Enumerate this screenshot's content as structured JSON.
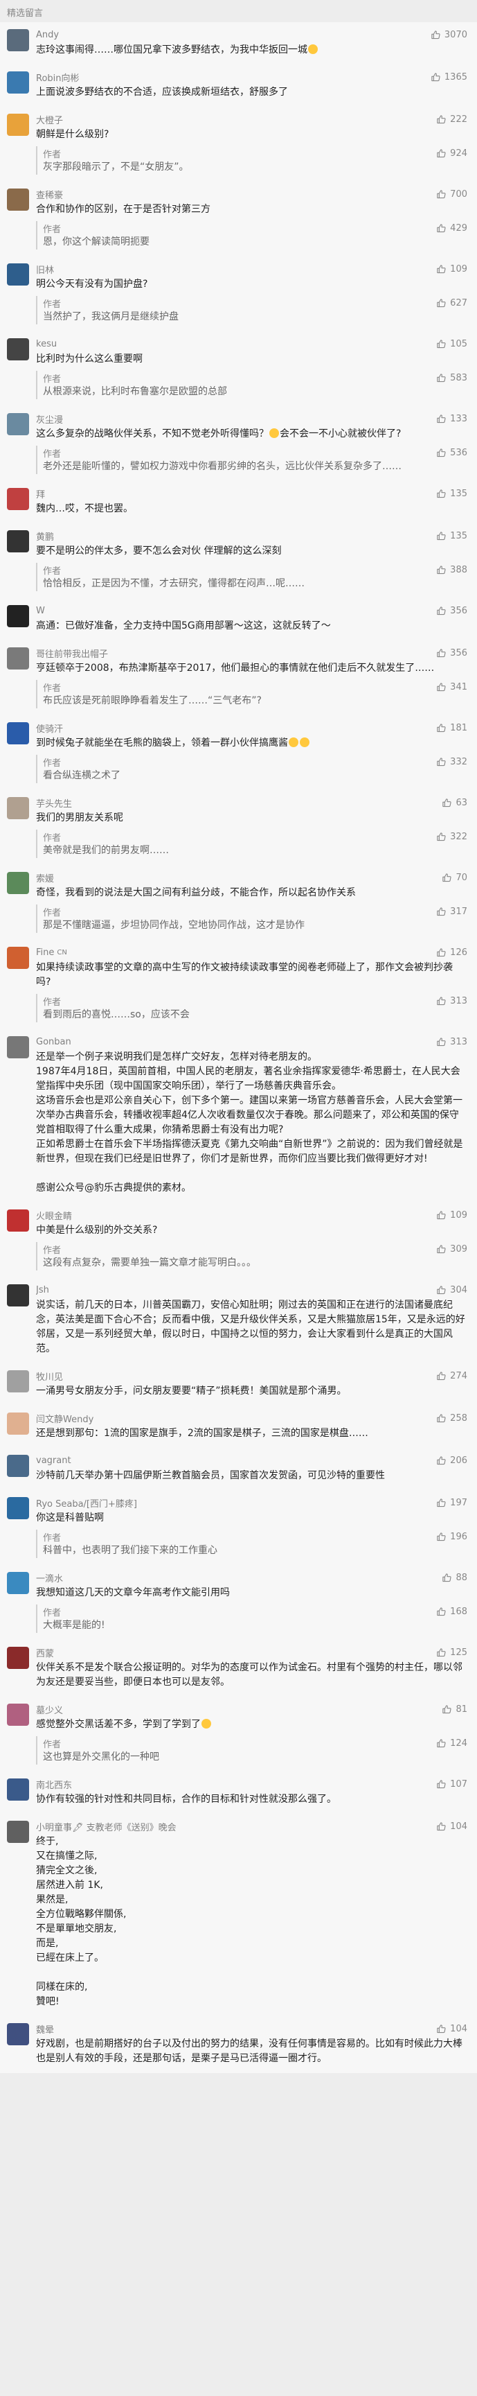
{
  "header": {
    "title": "精选留言"
  },
  "colors": {
    "background": "#f7f7f7",
    "name": "#808080",
    "text": "#222222",
    "reply_text": "#666666",
    "divider": "#d0d0d0"
  },
  "comments": [
    {
      "name": "Andy",
      "likes": "3070",
      "text": "志玲这事闹得……哪位国兄拿下波多野结衣，为我中华扳回一城",
      "emoji_after": true,
      "avatar_color": "#5a6b7c"
    },
    {
      "name": "Robin向彬",
      "likes": "1365",
      "text": "上面说波多野结衣的不合适，应该换成新垣结衣，舒服多了",
      "avatar_color": "#3a7ab0"
    },
    {
      "name": "大橙子",
      "likes": "222",
      "text": "朝鲜是什么级别?",
      "reply": {
        "label": "作者",
        "likes": "924",
        "text": "灰字那段暗示了，不是“女朋友”。"
      },
      "avatar_color": "#e8a23a"
    },
    {
      "name": "查稀豪",
      "likes": "700",
      "text": "合作和协作的区别，在于是否针对第三方",
      "reply": {
        "label": "作者",
        "likes": "429",
        "text": "恩，你这个解读简明扼要"
      },
      "avatar_color": "#8a6a4a"
    },
    {
      "name": "旧林",
      "likes": "109",
      "text": "明公今天有没有为国护盘?",
      "reply": {
        "label": "作者",
        "likes": "627",
        "text": "当然护了，我这俩月是继续护盘"
      },
      "avatar_color": "#2e5e8c"
    },
    {
      "name": "kesu",
      "likes": "105",
      "text": "比利时为什么这么重要啊",
      "reply": {
        "label": "作者",
        "likes": "583",
        "text": "从根源来说，比利时布鲁塞尔是欧盟的总部"
      },
      "avatar_color": "#444444"
    },
    {
      "name": "灰尘漫",
      "likes": "133",
      "text": "这么多复杂的战略伙伴关系，不知不觉老外听得懂吗？",
      "text_tail": "一不小心就被伙伴了?",
      "emoji_mid": true,
      "text_mid": "会不会",
      "reply": {
        "label": "作者",
        "likes": "536",
        "text": "老外还是能听懂的，譬如权力游戏中你看那劣绅的名头，远比伙伴关系复杂多了……"
      },
      "avatar_color": "#6a8aa0"
    },
    {
      "name": "拜",
      "likes": "135",
      "text": "魏内…哎，不提也罢。",
      "avatar_color": "#c04040",
      "name_emoji": true
    },
    {
      "name": "黄鹏",
      "likes": "135",
      "text": "要不是明公的伴太多，要不怎么会对伙 伴理解的这么深刻",
      "reply": {
        "label": "作者",
        "likes": "388",
        "text": "恰恰相反，正是因为不懂，才去研究，懂得都在闷声…呢……"
      },
      "avatar_color": "#333333"
    },
    {
      "name": "W",
      "likes": "356",
      "text": "高通：已做好准备，全力支持中国5G商用部署～这这，这就反转了～",
      "avatar_color": "#222222"
    },
    {
      "name": "哥往前带我出帽子",
      "likes": "356",
      "text": "亨廷顿卒于2008，布热津斯基卒于2017，他们最担心的事情就在他们走后不久就发生了……",
      "reply": {
        "label": "作者",
        "likes": "341",
        "text": "布氏应该是死前眼睁睁看着发生了……“三气老布”?"
      },
      "avatar_color": "#7a7a7a"
    },
    {
      "name": "使骑汗",
      "likes": "181",
      "text": "到时候兔子就能坐在毛熊的脑袋上，领着一群小伙伴搞鹰酱",
      "emoji_after2": true,
      "reply": {
        "label": "作者",
        "likes": "332",
        "text": "看合纵连横之术了"
      },
      "avatar_color": "#2a5caa"
    },
    {
      "name": "芋头先生",
      "likes": "63",
      "text": "我们的男朋友关系呢",
      "reply": {
        "label": "作者",
        "likes": "322",
        "text": "美帝就是我们的前男友啊……"
      },
      "avatar_color": "#b0a090"
    },
    {
      "name": "索媛",
      "likes": "70",
      "text": "奇怪，我看到的说法是大国之间有利益分歧，不能合作，所以起名协作关系",
      "reply": {
        "label": "作者",
        "likes": "317",
        "text": "那是不懂瞎逼逼，步坦协同作战，空地协同作战，这才是协作"
      },
      "avatar_color": "#5b8a5a"
    },
    {
      "name": "Fine",
      "name_suffix": "CN",
      "likes": "126",
      "text": "如果持续读政事堂的文章的高中生写的作文被持续读政事堂的阅卷老师碰上了，那作文会被判抄袭吗?",
      "reply": {
        "label": "作者",
        "likes": "313",
        "text": "看到雨后的喜悦……so，应该不会"
      },
      "avatar_color": "#d06030"
    },
    {
      "name": "Gonban",
      "likes": "313",
      "text": "还是举一个例子来说明我们是怎样广交好友，怎样对待老朋友的。\n1987年4月18日，英国前首相，中国人民的老朋友，著名业余指挥家爱德华·希思爵士，在人民大会堂指挥中央乐团（现中国国家交响乐团），举行了一场慈善庆典音乐会。\n这场音乐会也是邓公亲自关心下，创下多个第一。建国以来第一场官方慈善音乐会，人民大会堂第一次举办古典音乐会，转播收视率超4亿人次收看数量仅次于春晚。那么问题来了，邓公和英国的保守党首相取得了什么重大成果，你猜希思爵士有没有出力呢?\n正如希思爵士在首乐会下半场指挥德沃夏克《第九交响曲“自新世界”》之前说的：因为我们曾经就是新世界，但现在我们已经是旧世界了，你们才是新世界，而你们应当要比我们做得更好才对!\n\n感谢公众号@豹乐古典提供的素材。",
      "avatar_color": "#777777"
    },
    {
      "name": "火眼金睛",
      "likes": "109",
      "text": "中美是什么级别的外交关系?",
      "reply": {
        "label": "作者",
        "likes": "309",
        "text": "这段有点复杂，需要单独一篇文章才能写明白。。。"
      },
      "avatar_color": "#c03030"
    },
    {
      "name": "Jsh",
      "likes": "304",
      "text": "说实话，前几天的日本，川普英国霸刀，安倍心知肚明；刚过去的英国和正在进行的法国诸曼底纪念，英法美是面下合心不合；反而看中俄，又是升级伙伴关系，又是大熊猫旅居15年，又是永远的好邻居，又是一系列经贸大单，假以时日，中国持之以恒的努力，会让大家看到什么是真正的大国风范。",
      "avatar_color": "#333333"
    },
    {
      "name": "牧川见",
      "likes": "274",
      "text": "一涌男号女朋友分手，问女朋友要要“精子”损耗费！美国就是那个涌男。",
      "avatar_color": "#a0a0a0"
    },
    {
      "name": "闫文静Wendy",
      "likes": "258",
      "text": "还是想到那句：1流的国家是旗手，2流的国家是棋子，三流的国家是棋盘……",
      "avatar_color": "#e0b090"
    },
    {
      "name": "vagrant",
      "likes": "206",
      "text": "沙特前几天举办第十四届伊斯兰教首脑会员，国家首次发贺函，可见沙特的重要性",
      "avatar_color": "#4a6a8a"
    },
    {
      "name": "Ryo Seaba/[西门+膝疼]",
      "likes": "197",
      "text": "你这是科普贴啊",
      "reply": {
        "label": "作者",
        "likes": "196",
        "text": "科普中，也表明了我们接下来的工作重心"
      },
      "avatar_color": "#2a6aa0"
    },
    {
      "name": "一滴水",
      "likes": "88",
      "text": "我想知道这几天的文章今年高考作文能引用吗",
      "reply": {
        "label": "作者",
        "likes": "168",
        "text": "大概率是能的!"
      },
      "avatar_color": "#3a8ac0"
    },
    {
      "name": "西蒙",
      "likes": "125",
      "text": "伙伴关系不是发个联合公报证明的。对华为的态度可以作为试金石。村里有个强势的村主任，哪以邻为友还是要妥当些，即便日本也可以是友邻。",
      "avatar_color": "#8a2a2a"
    },
    {
      "name": "墓少义",
      "likes": "81",
      "text": "感觉整外交黑话差不多，学到了学到了",
      "emoji_after3": true,
      "reply": {
        "label": "作者",
        "likes": "124",
        "text": "这也算是外交黑化的一种吧"
      },
      "avatar_color": "#b06080"
    },
    {
      "name": "南北西东",
      "likes": "107",
      "text": "协作有较强的针对性和共同目标，合作的目标和针对性就没那么强了。",
      "avatar_color": "#3a5a8a"
    },
    {
      "name": "小明童事🖋 支教老师《送别》晚会",
      "likes": "104",
      "text": "终于,\n又在搞懂之际,\n猜完全文之後,\n居然进入前 1K,\n果然是,\n全方位戰略夥伴關係,\n不是單單地交朋友,\n而是,\n已經在床上了。\n\n同樣在床的,\n贊吧!",
      "avatar_color": "#606060"
    },
    {
      "name": "魏晕",
      "likes": "104",
      "text": "好戏剧，也是前期搭好的台子以及付出的努力的结果，没有任何事情是容易的。比如有时候此力大棒也是别人有效的手段，还是那句话，是栗子是马已活得逼一圈才行。",
      "avatar_color": "#405080"
    }
  ]
}
